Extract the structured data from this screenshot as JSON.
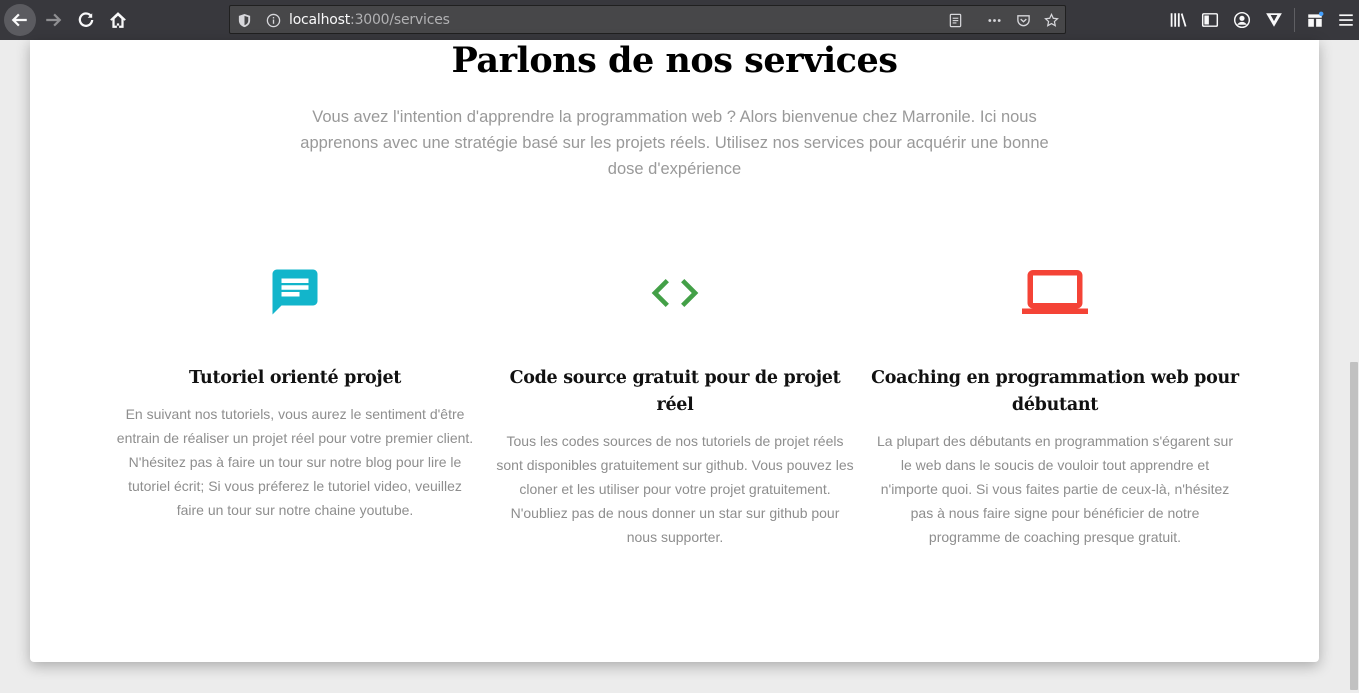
{
  "browser": {
    "url_host": "localhost",
    "url_path": ":3000/services"
  },
  "page": {
    "title": "Parlons de nos services",
    "intro": "Vous avez l'intention d'apprendre la programmation web ? Alors bienvenue chez Marronile. Ici nous apprenons avec une stratégie basé sur les projets réels. Utilisez nos services pour acquérir une bonne dose d'expérience"
  },
  "services": [
    {
      "icon": "chat-message-icon",
      "color": "#12b5cb",
      "title": "Tutoriel orienté projet",
      "text": "En suivant nos tutoriels, vous aurez le sentiment d'être entrain de réaliser un projet réel pour votre premier client. N'hésitez pas à faire un tour sur notre blog pour lire le tutoriel écrit; Si vous préferez le tutoriel video, veuillez faire un tour sur notre chaine youtube."
    },
    {
      "icon": "code-brackets-icon",
      "color": "#43a047",
      "title": "Code source gratuit pour de projet réel",
      "text": "Tous les codes sources de nos tutoriels de projet réels sont disponibles gratuitement sur github. Vous pouvez les cloner et les utiliser pour votre projet gratuitement. N'oubliez pas de nous donner un star sur github pour nous supporter."
    },
    {
      "icon": "laptop-icon",
      "color": "#f44336",
      "title": "Coaching en programmation web pour débutant",
      "text": "La plupart des débutants en programmation s'égarent sur le web dans le soucis de vouloir tout apprendre et n'importe quoi. Si vous faites partie de ceux-là, n'hésitez pas à nous faire signe pour bénéficier de notre programme de coaching presque gratuit."
    }
  ]
}
